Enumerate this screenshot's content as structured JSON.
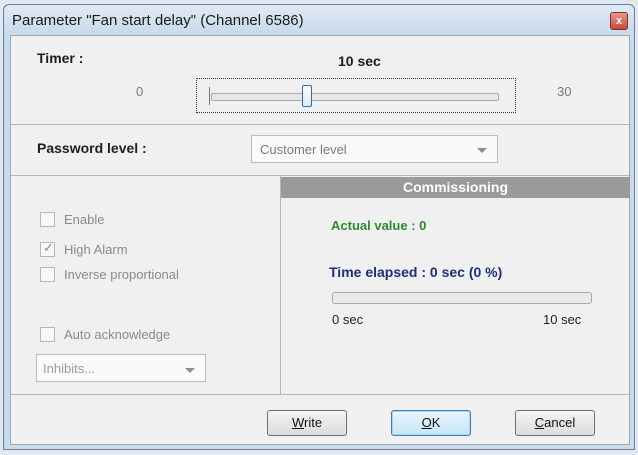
{
  "window": {
    "title": "Parameter \"Fan start delay\" (Channel 6586)",
    "close_glyph": "x"
  },
  "timer": {
    "label": "Timer :",
    "value_text": "10 sec",
    "min": "0",
    "max": "30",
    "value": 10
  },
  "password": {
    "label": "Password level :",
    "selected": "Customer level"
  },
  "options": [
    {
      "label": "Enable",
      "checked": false
    },
    {
      "label": "High Alarm",
      "checked": true
    },
    {
      "label": "Inverse proportional",
      "checked": false
    },
    {
      "label": "Auto acknowledge",
      "checked": false
    }
  ],
  "inhibits": {
    "selected": "Inhibits..."
  },
  "commissioning": {
    "header": "Commissioning",
    "actual_value": "Actual value : 0",
    "time_elapsed": "Time elapsed : 0 sec (0 %)",
    "progress_percent": 0,
    "progress_min": "0 sec",
    "progress_max": "10 sec"
  },
  "buttons": {
    "write_mnemonic": "W",
    "write_rest": "rite",
    "ok_mnemonic": "O",
    "ok_rest": "K",
    "cancel_mnemonic": "C",
    "cancel_rest": "ancel"
  },
  "colors": {
    "actual_value": "#2f8a2f",
    "time_elapsed": "#1d2f78",
    "commissioning_header": "#9a9a9a"
  }
}
